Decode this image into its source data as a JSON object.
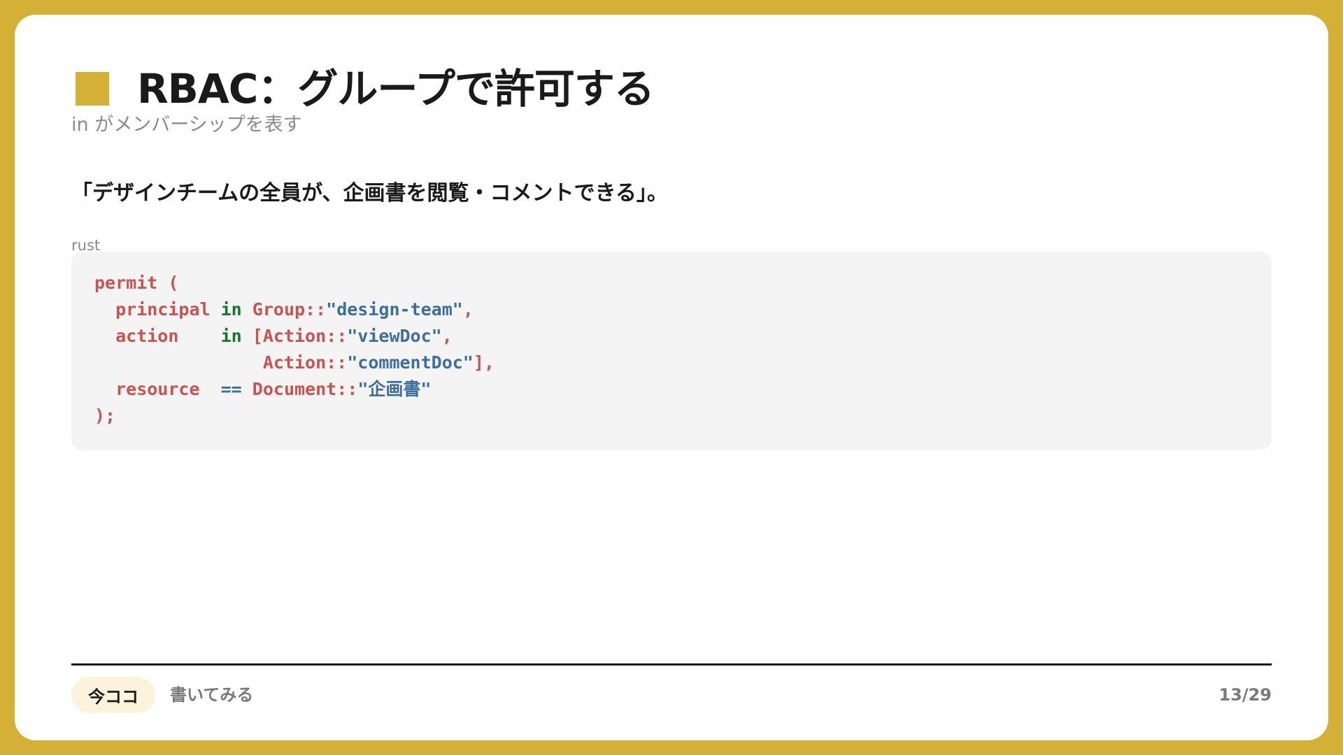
{
  "slide": {
    "title": "RBAC：グループで許可する",
    "subtitle": "in がメンバーシップを表す",
    "lead": "「デザインチームの全員が、企画書を閲覧・コメントできる」。",
    "code_language": "rust",
    "code_lines": [
      [
        {
          "t": "permit (",
          "c": "kw"
        }
      ],
      [
        {
          "t": "  principal ",
          "c": "kw"
        },
        {
          "t": "in",
          "c": "in"
        },
        {
          "t": " Group::",
          "c": "kw"
        },
        {
          "t": "\"design-team\"",
          "c": "str"
        },
        {
          "t": ",",
          "c": "kw"
        }
      ],
      [
        {
          "t": "  action    ",
          "c": "kw"
        },
        {
          "t": "in",
          "c": "in"
        },
        {
          "t": " [Action::",
          "c": "kw"
        },
        {
          "t": "\"viewDoc\"",
          "c": "str"
        },
        {
          "t": ",",
          "c": "kw"
        }
      ],
      [
        {
          "t": "                Action::",
          "c": "kw"
        },
        {
          "t": "\"commentDoc\"",
          "c": "str"
        },
        {
          "t": "],",
          "c": "kw"
        }
      ],
      [
        {
          "t": "  resource  ",
          "c": "kw"
        },
        {
          "t": "==",
          "c": "str"
        },
        {
          "t": " Document::",
          "c": "kw"
        },
        {
          "t": "\"企画書\"",
          "c": "str"
        }
      ],
      [
        {
          "t": ");",
          "c": "kw"
        }
      ]
    ]
  },
  "footer": {
    "current_badge": "今ココ",
    "section": "書いてみる",
    "page": "13/29"
  },
  "colors": {
    "accent": "#d4b037",
    "keyword": "#c75450",
    "in_keyword": "#16752f",
    "string": "#3d6e9e"
  }
}
